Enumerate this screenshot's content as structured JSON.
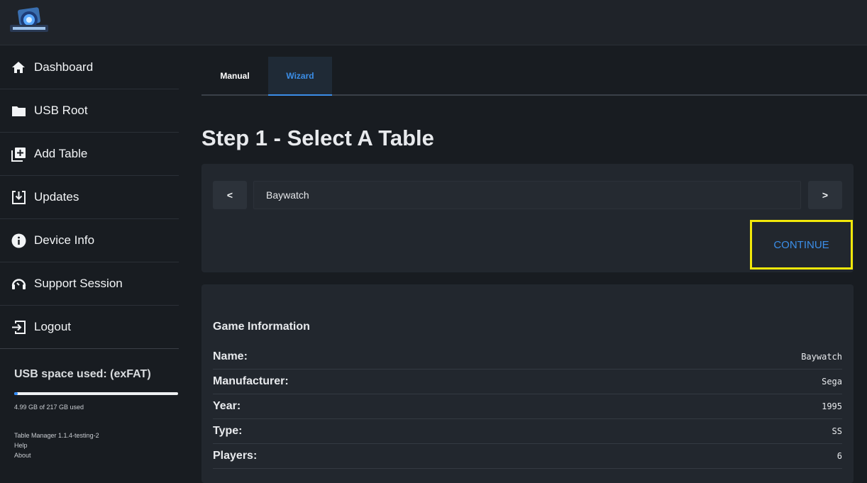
{
  "sidebar": {
    "items": [
      {
        "label": "Dashboard",
        "icon": "home-icon"
      },
      {
        "label": "USB Root",
        "icon": "folder-icon"
      },
      {
        "label": "Add Table",
        "icon": "add-library-icon"
      },
      {
        "label": "Updates",
        "icon": "download-box-icon"
      },
      {
        "label": "Device Info",
        "icon": "info-icon"
      },
      {
        "label": "Support Session",
        "icon": "headset-icon"
      },
      {
        "label": "Logout",
        "icon": "logout-icon"
      }
    ],
    "usb": {
      "title": "USB space used: (exFAT)",
      "used_fraction": 0.023,
      "usage_text": "4.99 GB of 217 GB used"
    },
    "footer": {
      "version": "Table Manager 1.1.4-testing-2",
      "help": "Help",
      "about": "About"
    }
  },
  "tabs": [
    {
      "label": "Manual",
      "active": false
    },
    {
      "label": "Wizard",
      "active": true
    }
  ],
  "step_title": "Step 1 - Select A Table",
  "selector": {
    "prev_label": "<",
    "next_label": ">",
    "current_table": "Baywatch",
    "continue_label": "CONTINUE"
  },
  "game_info": {
    "heading": "Game Information",
    "rows": [
      {
        "key": "Name:",
        "value": "Baywatch"
      },
      {
        "key": "Manufacturer:",
        "value": "Sega"
      },
      {
        "key": "Year:",
        "value": "1995"
      },
      {
        "key": "Type:",
        "value": "SS"
      },
      {
        "key": "Players:",
        "value": "6"
      }
    ]
  },
  "colors": {
    "accent": "#3b8ee8",
    "highlight_box": "#f2e80a",
    "background": "#181c21",
    "card": "#22272e"
  }
}
